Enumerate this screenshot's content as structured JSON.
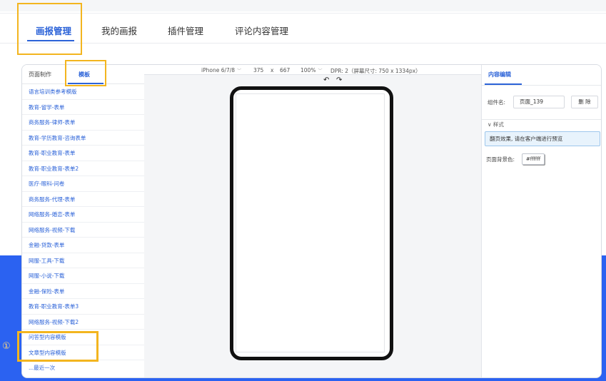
{
  "top_nav": {
    "tabs": [
      {
        "label": "画报管理",
        "active": true
      },
      {
        "label": "我的画报",
        "active": false
      },
      {
        "label": "插件管理",
        "active": false
      },
      {
        "label": "评论内容管理",
        "active": false
      }
    ]
  },
  "left_panel": {
    "tabs": [
      {
        "label": "页面制作",
        "active": false
      },
      {
        "label": "模板",
        "active": true
      }
    ],
    "templates": [
      "语言培训类参考模版",
      "教育-留学-表单",
      "商务服务-律师-表单",
      "教育-学历教育-咨询表单",
      "教育-职业教育-表单",
      "教育-职业教育-表单2",
      "医疗-眼科-问卷",
      "商务服务-代理-表单",
      "网络服务-婚恋-表单",
      "网络服务-视频-下载",
      "金融-贷款-表单",
      "网服-工具-下载",
      "网服-小说-下载",
      "金融-保险-表单",
      "教育-职业教育-表单3",
      "网络服务-视频-下载2",
      "问答型内容模版",
      "文章型内容模版"
    ],
    "recent": "...最近一次"
  },
  "toolbar": {
    "device": "iPhone 6/7/8",
    "width": "375",
    "x": "x",
    "height": "667",
    "zoom": "100%",
    "dpr": "DPR: 2（屏幕尺寸: 750 x 1334px）",
    "undo_icon": "undo-arrow",
    "redo_icon": "redo-arrow"
  },
  "right_panel": {
    "tab": "内容编辑",
    "component_name_label": "组件名:",
    "component_name_value": "页面_139",
    "delete_label": "删 除",
    "style_section": "样式",
    "notice": "翻页效果, 请在客户端进行预览",
    "bg_color_label": "页面背景色:",
    "bg_color_value": "#ffffff"
  },
  "annotation": {
    "step_marker": "①"
  },
  "colors": {
    "accent": "#2c63d8",
    "highlight": "#f3b51f",
    "blue_band": "#2b62f1"
  }
}
